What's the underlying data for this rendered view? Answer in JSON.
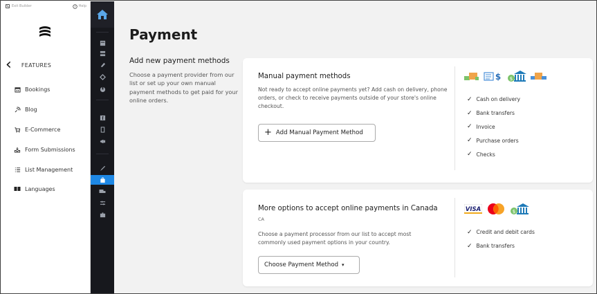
{
  "topbar": {
    "exit_label": "Exit Builder",
    "help_label": "Help"
  },
  "features": {
    "header": "FEATURES",
    "items": [
      {
        "label": "Bookings",
        "icon": "calendar-icon"
      },
      {
        "label": "Blog",
        "icon": "blog-icon"
      },
      {
        "label": "E-Commerce",
        "icon": "cart-icon"
      },
      {
        "label": "Form Submissions",
        "icon": "inbox-icon"
      },
      {
        "label": "List Management",
        "icon": "list-icon"
      },
      {
        "label": "Languages",
        "icon": "languages-icon"
      }
    ]
  },
  "page": {
    "title": "Payment",
    "intro_title": "Add new payment methods",
    "intro_text": "Choose a payment provider from our list or set up your own manual payment methods to get paid for your online orders."
  },
  "manual": {
    "title": "Manual payment methods",
    "text": "Not ready to accept online payments yet? Add cash on delivery, phone orders, or check to receive payments outside of your store's online checkout.",
    "button": "Add Manual Payment Method",
    "checks": [
      "Cash on delivery",
      "Bank transfers",
      "Invoice",
      "Purchase orders",
      "Checks"
    ]
  },
  "online": {
    "title": "More options to accept online payments in Canada",
    "country_code": "CA",
    "text": "Choose a payment processor from our list to accept most commonly used payment options in your country.",
    "button": "Choose Payment Method",
    "checks": [
      "Credit and debit cards",
      "Bank transfers"
    ],
    "visa_label": "VISA"
  },
  "colors": {
    "rail_bg": "#17181d",
    "active": "#1e88e5",
    "page_bg": "#f2f2f2"
  }
}
